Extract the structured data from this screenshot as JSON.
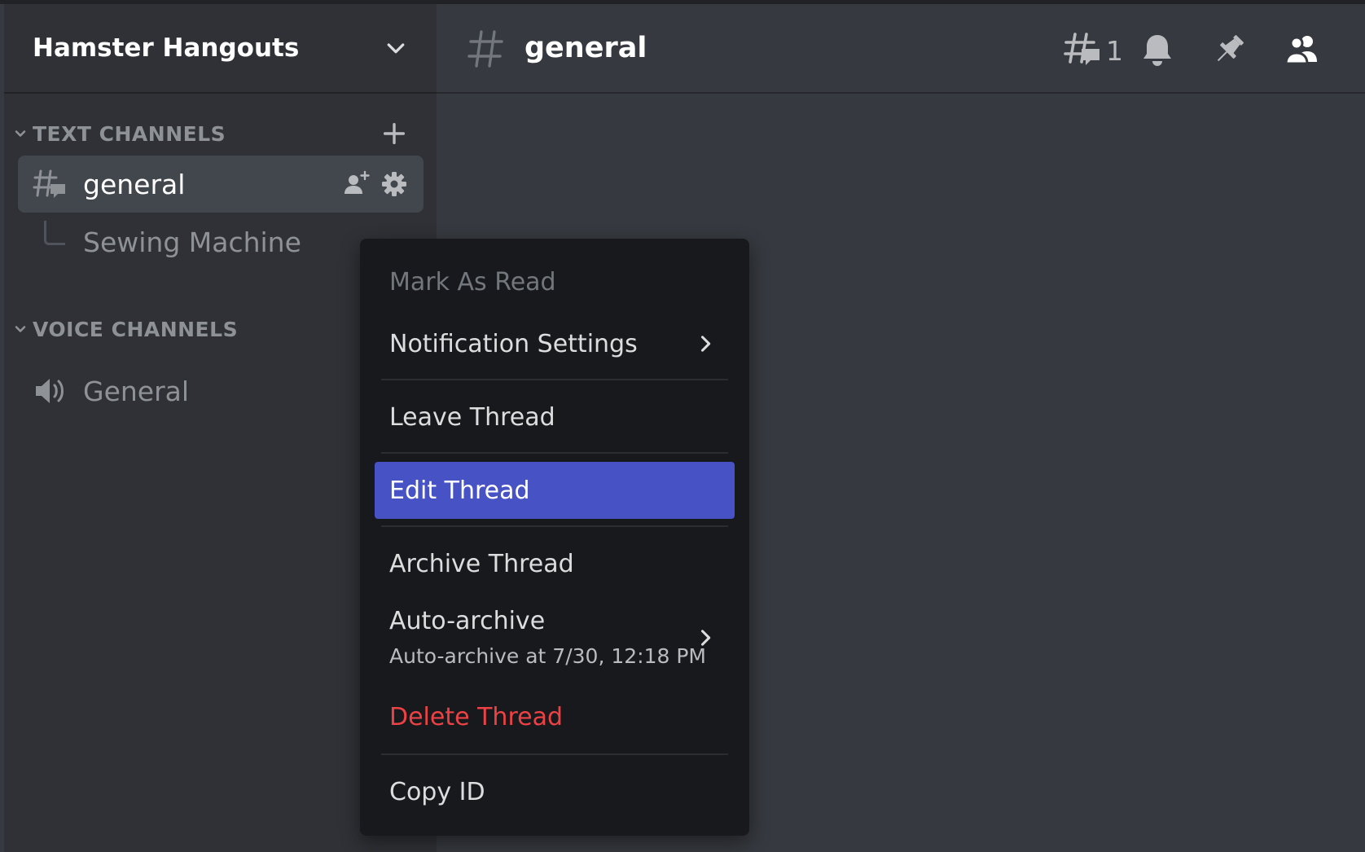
{
  "server": {
    "name": "Hamster Hangouts"
  },
  "categories": {
    "text": {
      "label": "TEXT CHANNELS"
    },
    "voice": {
      "label": "VOICE CHANNELS"
    }
  },
  "channels": {
    "general": {
      "name": "general"
    },
    "thread": {
      "name": "Sewing Machine"
    },
    "voice_general": {
      "name": "General"
    }
  },
  "header": {
    "channel_name": "general",
    "thread_count": "1"
  },
  "context_menu": {
    "mark_as_read": "Mark As Read",
    "notification_settings": "Notification Settings",
    "leave_thread": "Leave Thread",
    "edit_thread": "Edit Thread",
    "archive_thread": "Archive Thread",
    "auto_archive": "Auto-archive",
    "auto_archive_sub": "Auto-archive at 7/30, 12:18 PM",
    "delete_thread": "Delete Thread",
    "copy_id": "Copy ID"
  },
  "colors": {
    "accent": "#4752c4",
    "danger": "#ed4245",
    "sidebar": "#2f3136",
    "main": "#36393f",
    "menu": "#18191c"
  }
}
